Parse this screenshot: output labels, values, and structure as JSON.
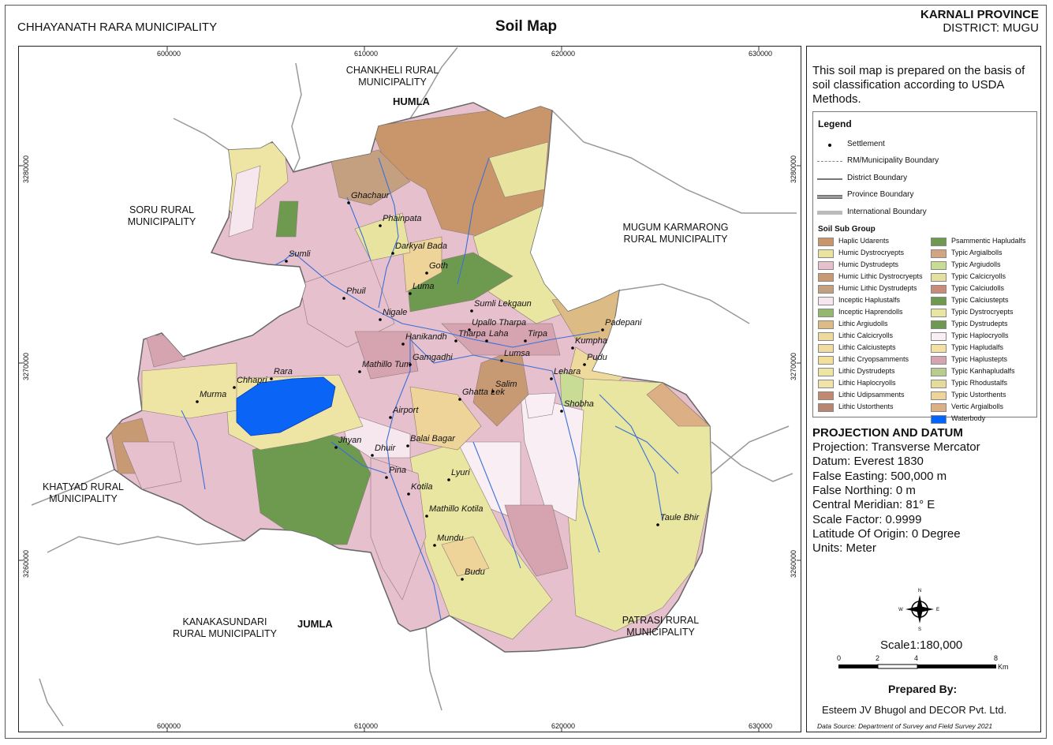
{
  "header": {
    "municipality": "CHHAYANATH RARA MUNICIPALITY",
    "title": "Soil Map",
    "province": "KARNALI PROVINCE",
    "district": "DISTRICT: MUGU"
  },
  "grid": {
    "x_ticks": [
      "600000",
      "610000",
      "620000",
      "630000"
    ],
    "y_ticks": [
      "3280000",
      "3270000",
      "3260000"
    ]
  },
  "regions": {
    "chankheli": "CHANKHELI RURAL MUNICIPALITY",
    "humla": "HUMLA",
    "soru": "SORU RURAL MUNICIPALITY",
    "mugum": "MUGUM KARMARONG RURAL MUNICIPALITY",
    "khatyad": "KHATYAD RURAL MUNICIPALITY",
    "kanakasundari": "KANAKASUNDARI RURAL MUNICIPALITY",
    "jumla": "JUMLA",
    "patrasi": "PATRASI RURAL MUNICIPALITY"
  },
  "settlements": [
    "Ghachaur",
    "Phainpata",
    "Darkyal Bada",
    "Sumli",
    "Goth",
    "Luma",
    "Phuil",
    "Sumli Lekgaun",
    "Nigale",
    "Upallo Tharpa",
    "Padepani",
    "Hanikandh",
    "Tharpa",
    "Laha",
    "Tirpa",
    "Kumpha",
    "Lumsa",
    "Pudu",
    "Mathillo Tum",
    "Gamgadhi",
    "Lehara",
    "Rara",
    "Chhapri",
    "Salim",
    "Murma",
    "Ghatta Lek",
    "Shobha",
    "Airport",
    "Jhyan",
    "Balai Bagar",
    "Dhuir",
    "Lyuri",
    "Pina",
    "Kotila",
    "Mathillo Kotila",
    "Taule Bhir",
    "Mundu",
    "Budu"
  ],
  "panel": {
    "intro": "This soil map is prepared on  the basis of soil classification  according to USDA Methods.",
    "legend_title": "Legend",
    "symbols": [
      "Settlement",
      "RM/Municipality Boundary",
      "District Boundary",
      "Province Boundary",
      "International Boundary"
    ],
    "soil_title": "Soil Sub Group",
    "soil_groups": [
      {
        "name": "Haplic Udarents",
        "color": "#c8966a"
      },
      {
        "name": "Humic Dystrocryepts",
        "color": "#e8e4a0"
      },
      {
        "name": "Humic Dystrudepts",
        "color": "#e6c0cc"
      },
      {
        "name": "Humic Lithic Dystrocryepts",
        "color": "#c89a74"
      },
      {
        "name": "Humic Lithic Dystrudepts",
        "color": "#c4a080"
      },
      {
        "name": "Inceptic Haplustalfs",
        "color": "#f6e6ee"
      },
      {
        "name": "Inceptic Haprendolls",
        "color": "#94b870"
      },
      {
        "name": "Lithic Argiudolls",
        "color": "#dcbc84"
      },
      {
        "name": "Lithic Calcicryolls",
        "color": "#eeda9c"
      },
      {
        "name": "Lithic Calciustepts",
        "color": "#f0dca0"
      },
      {
        "name": "Lithic Cryopsamments",
        "color": "#f2e09a"
      },
      {
        "name": "Lithic Dystrudepts",
        "color": "#eee4a4"
      },
      {
        "name": "Lithic Haplocryolls",
        "color": "#f0e2a8"
      },
      {
        "name": "Lithic Udipsamments",
        "color": "#c08a70"
      },
      {
        "name": "Lithic Ustorthents",
        "color": "#b88670"
      },
      {
        "name": "Psammentic Hapludalfs",
        "color": "#6e9a50"
      },
      {
        "name": "Typic Argialbolls",
        "color": "#d2a482"
      },
      {
        "name": "Typic Argiudolls",
        "color": "#c8dc96"
      },
      {
        "name": "Typic Calcicryolls",
        "color": "#e6e0a0"
      },
      {
        "name": "Typic Calciudolls",
        "color": "#c88c78"
      },
      {
        "name": "Typic Calciustepts",
        "color": "#6e9a50"
      },
      {
        "name": "Typic Dystrocryepts",
        "color": "#e8e6a0"
      },
      {
        "name": "Typic Dystrudepts",
        "color": "#6e9a50"
      },
      {
        "name": "Typic Haplocryolls",
        "color": "#f8eef4"
      },
      {
        "name": "Typic Hapludalfs",
        "color": "#f4e0a0"
      },
      {
        "name": "Typic Haplustepts",
        "color": "#d6a4b0"
      },
      {
        "name": "Typic Kanhapludalfs",
        "color": "#b8cc8c"
      },
      {
        "name": "Typic Rhodustalfs",
        "color": "#e4dc98"
      },
      {
        "name": "Typic Ustorthents",
        "color": "#eed498"
      },
      {
        "name": "Vertic Argialbolls",
        "color": "#dcb084"
      },
      {
        "name": "Waterbody",
        "color": "#0064ff"
      }
    ],
    "projection_title": "PROJECTION AND DATUM",
    "projection_lines": [
      "Projection: Transverse Mercator",
      "Datum: Everest 1830",
      "False Easting: 500,000 m",
      "False Northing: 0 m",
      "Central Meridian: 81° E",
      "Scale Factor: 0.9999",
      "Latitude Of Origin: 0 Degree",
      "Units: Meter"
    ],
    "north_labels": [
      "N",
      "W",
      "E",
      "S"
    ],
    "scale_text": "Scale1:180,000",
    "scale_ticks": [
      "0",
      "2",
      "4",
      "8"
    ],
    "scale_unit": "Km",
    "prepared_title": "Prepared By:",
    "prepared_by": "Esteem JV Bhugol and DECOR Pvt. Ltd.",
    "data_source": "Data Source: Department of Survey and Field Survey 2021"
  }
}
